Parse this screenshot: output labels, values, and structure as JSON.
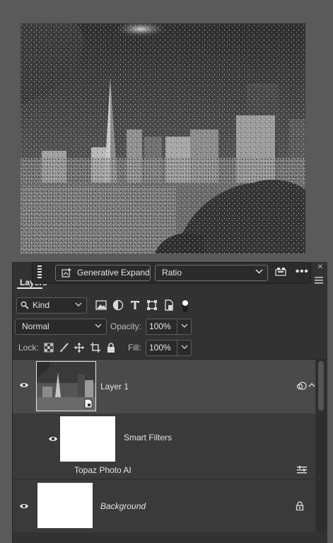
{
  "panel": {
    "tab_label": "Layers"
  },
  "task_bar": {
    "generative_expand_label": "Generative Expand",
    "ratio_label": "Ratio",
    "more_label": "•••"
  },
  "filter": {
    "kind_label": "Kind"
  },
  "blend": {
    "mode_label": "Normal",
    "opacity_label": "Opacity:",
    "opacity_value": "100%"
  },
  "lock": {
    "lock_label": "Lock:",
    "fill_label": "Fill:",
    "fill_value": "100%"
  },
  "layers": {
    "layer1_name": "Layer 1",
    "smart_filters_label": "Smart Filters",
    "filter_name": "Topaz Photo AI",
    "background_name": "Background"
  },
  "colors": {
    "workspace": "#5a5a5a",
    "panel": "#323232",
    "selected_row": "#4a4a4a"
  }
}
